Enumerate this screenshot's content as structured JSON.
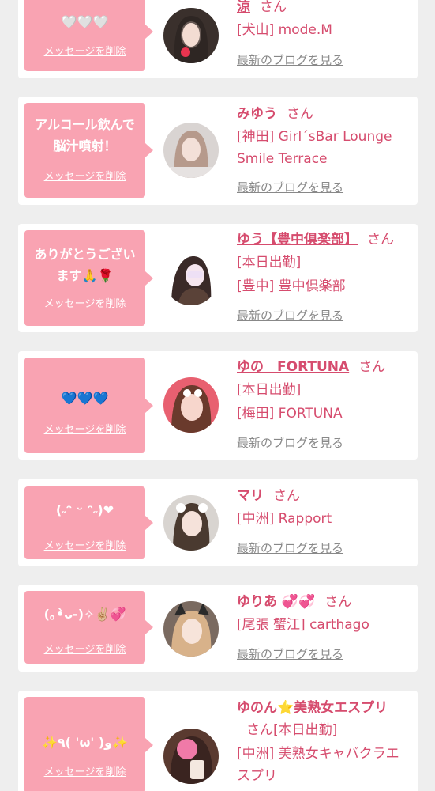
{
  "theme": {
    "background": "#eeeeee",
    "card": "#ffffff",
    "bubble": "#f9a3b2",
    "accent": "#d64c6e",
    "muted": "#888888"
  },
  "labels": {
    "delete": "メッセージを削除",
    "blog": "最新のブログを見る",
    "honorific": "さん"
  },
  "cards": [
    {
      "message": "🤍🤍🤍",
      "name": "涼",
      "details": [
        "[犬山] mode.M"
      ]
    },
    {
      "message": "アルコール飲んで\n脳汁噴射！",
      "name": "みゆう",
      "details": [
        "[神田] Girl´sBar Lounge Smile Terrace"
      ]
    },
    {
      "message": "ありがとうござい\nます🙏🌹",
      "name": "ゆう【豊中倶楽部】",
      "details": [
        "[本日出勤]",
        "[豊中] 豊中倶楽部"
      ]
    },
    {
      "message": "💙💙💙",
      "name": "ゆの　FORTUNA",
      "details": [
        "[本日出勤]",
        "[梅田] FORTUNA"
      ]
    },
    {
      "message": "(˶ᵔ ᵕ ᵔ˶)❤",
      "name": "マリ",
      "details": [
        "[中洲] Rapport"
      ]
    },
    {
      "message": "(｡•̀ᴗ-)✧✌🏼💞",
      "name": "ゆりあ 💞💞",
      "details": [
        "[尾張 蟹江] carthago"
      ]
    },
    {
      "message": "✨٩( 'ω' )و✨",
      "name": "ゆのん⭐美熟女エスプリ",
      "inline_detail": "[本日出勤]",
      "details": [
        "[中洲] 美熟女キャバクラエスプリ"
      ]
    }
  ]
}
